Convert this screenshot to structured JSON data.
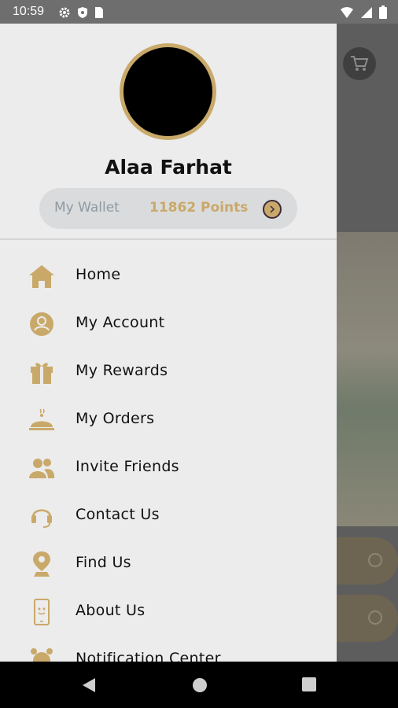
{
  "status": {
    "time": "10:59"
  },
  "profile": {
    "name": "Alaa Farhat"
  },
  "wallet": {
    "label": "My Wallet",
    "points": "11862 Points"
  },
  "menu": [
    {
      "label": "Home",
      "icon": "home-icon"
    },
    {
      "label": "My Account",
      "icon": "account-icon"
    },
    {
      "label": "My Rewards",
      "icon": "gift-icon"
    },
    {
      "label": "My Orders",
      "icon": "cloche-icon"
    },
    {
      "label": "Invite Friends",
      "icon": "friends-icon"
    },
    {
      "label": "Contact Us",
      "icon": "headset-icon"
    },
    {
      "label": "Find Us",
      "icon": "location-pin-icon"
    },
    {
      "label": "About Us",
      "icon": "phone-icon"
    },
    {
      "label": "Notification Center",
      "icon": "alarm-icon"
    }
  ],
  "colors": {
    "accent": "#c9a96a",
    "drawer_bg": "#ececec",
    "wallet_bg": "#dadbdc",
    "wallet_label": "#8d9aa4"
  }
}
